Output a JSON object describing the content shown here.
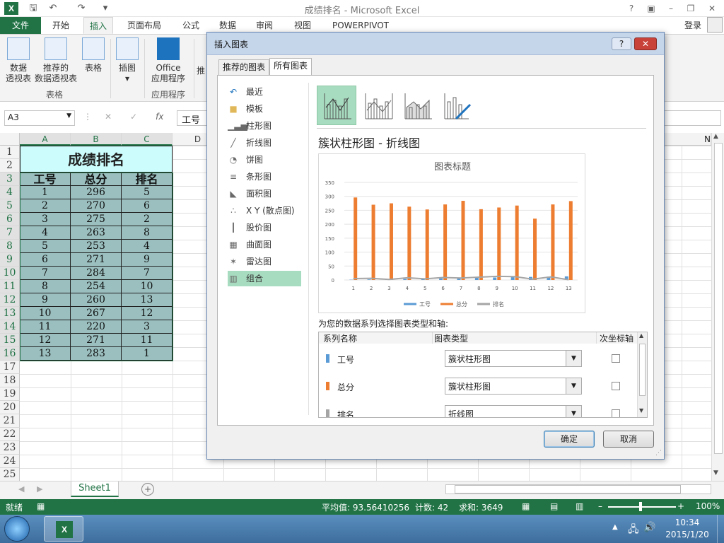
{
  "window": {
    "title": "成绩排名 - Microsoft Excel",
    "login": "登录"
  },
  "ribbon": {
    "tabs": [
      "文件",
      "开始",
      "插入",
      "页面布局",
      "公式",
      "数据",
      "审阅",
      "视图",
      "POWERPIVOT"
    ],
    "active_tab": "插入",
    "buttons": {
      "pivot": [
        "数据",
        "透视表"
      ],
      "recommended_pivot": [
        "推荐的",
        "数据透视表"
      ],
      "table": "表格",
      "illustrations": "插图",
      "office_apps": [
        "Office",
        "应用程序"
      ],
      "recommended_charts_partial": "推"
    },
    "groups": {
      "tables": "表格",
      "apps": "应用程序"
    }
  },
  "formula_bar": {
    "name_box": "A3",
    "fx_label": "fx",
    "content": "工号"
  },
  "sheet": {
    "columns": [
      "A",
      "B",
      "C",
      "D"
    ],
    "right_column_partial": "N",
    "rows": [
      "1",
      "2",
      "3",
      "4",
      "5",
      "6",
      "7",
      "8",
      "9",
      "10",
      "11",
      "12",
      "13",
      "14",
      "15",
      "16",
      "17",
      "18",
      "19",
      "20",
      "21",
      "22",
      "23",
      "24",
      "25"
    ],
    "title": "成绩排名",
    "headers": [
      "工号",
      "总分",
      "排名"
    ],
    "data": [
      [
        "1",
        "296",
        "5"
      ],
      [
        "2",
        "270",
        "6"
      ],
      [
        "3",
        "275",
        "2"
      ],
      [
        "4",
        "263",
        "8"
      ],
      [
        "5",
        "253",
        "4"
      ],
      [
        "6",
        "271",
        "9"
      ],
      [
        "7",
        "284",
        "7"
      ],
      [
        "8",
        "254",
        "10"
      ],
      [
        "9",
        "260",
        "13"
      ],
      [
        "10",
        "267",
        "12"
      ],
      [
        "11",
        "220",
        "3"
      ],
      [
        "12",
        "271",
        "11"
      ],
      [
        "13",
        "283",
        "1"
      ]
    ],
    "tab_name": "Sheet1"
  },
  "status_bar": {
    "mode": "就绪",
    "average": "平均值: 93.56410256",
    "count": "计数: 42",
    "sum": "求和: 3649",
    "zoom": "100%"
  },
  "taskbar": {
    "time": "10:34",
    "date": "2015/1/20"
  },
  "dialog": {
    "title": "插入图表",
    "tabs": [
      "推荐的图表",
      "所有图表"
    ],
    "active_tab": "所有图表",
    "chart_types": [
      {
        "label": "最近",
        "icon": "recent-icon"
      },
      {
        "label": "模板",
        "icon": "folder-icon"
      },
      {
        "label": "柱形图",
        "icon": "column-chart-icon"
      },
      {
        "label": "折线图",
        "icon": "line-chart-icon"
      },
      {
        "label": "饼图",
        "icon": "pie-chart-icon"
      },
      {
        "label": "条形图",
        "icon": "bar-chart-icon"
      },
      {
        "label": "面积图",
        "icon": "area-chart-icon"
      },
      {
        "label": "X Y (散点图)",
        "icon": "scatter-chart-icon"
      },
      {
        "label": "股价图",
        "icon": "stock-chart-icon"
      },
      {
        "label": "曲面图",
        "icon": "surface-chart-icon"
      },
      {
        "label": "雷达图",
        "icon": "radar-chart-icon"
      },
      {
        "label": "组合",
        "icon": "combo-chart-icon"
      }
    ],
    "selected_type": "组合",
    "subtype_title": "簇状柱形图 - 折线图",
    "series_prompt": "为您的数据系列选择图表类型和轴:",
    "table_headers": [
      "系列名称",
      "图表类型",
      "次坐标轴"
    ],
    "series": [
      {
        "name": "工号",
        "type": "簇状柱形图",
        "color": "#5b9bd5"
      },
      {
        "name": "总分",
        "type": "簇状柱形图",
        "color": "#ed7d31"
      },
      {
        "name": "排名",
        "type": "折线图",
        "color": "#a5a5a5"
      }
    ],
    "ok_label": "确定",
    "cancel_label": "取消"
  },
  "chart_data": {
    "type": "bar",
    "title": "图表标题",
    "categories": [
      "1",
      "2",
      "3",
      "4",
      "5",
      "6",
      "7",
      "8",
      "9",
      "10",
      "11",
      "12",
      "13"
    ],
    "ylim": [
      0,
      350
    ],
    "yticks": [
      "0",
      "50",
      "100",
      "150",
      "200",
      "250",
      "300",
      "350"
    ],
    "series": [
      {
        "name": "工号",
        "kind": "bar",
        "color": "#5b9bd5",
        "values": [
          1,
          2,
          3,
          4,
          5,
          6,
          7,
          8,
          9,
          10,
          11,
          12,
          13
        ]
      },
      {
        "name": "总分",
        "kind": "bar",
        "color": "#ed7d31",
        "values": [
          296,
          270,
          275,
          263,
          253,
          271,
          284,
          254,
          260,
          267,
          220,
          271,
          283
        ]
      },
      {
        "name": "排名",
        "kind": "line",
        "color": "#a5a5a5",
        "values": [
          5,
          6,
          2,
          8,
          4,
          9,
          7,
          10,
          13,
          12,
          3,
          11,
          1
        ]
      }
    ],
    "legend": "bottom",
    "grid": true
  }
}
